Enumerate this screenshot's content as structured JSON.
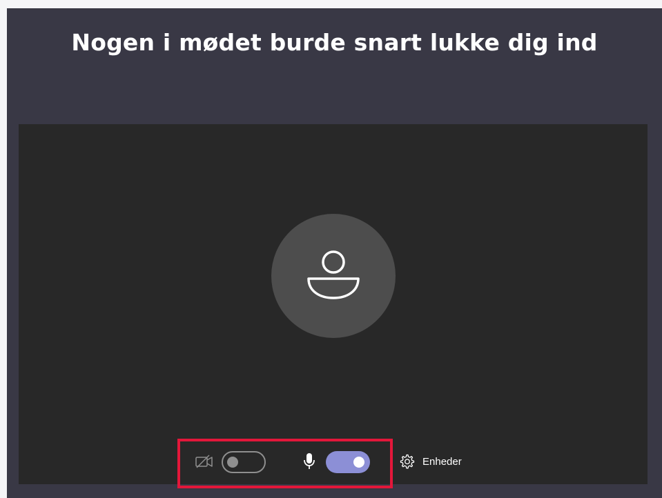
{
  "title": "Nogen i mødet burde snart lukke dig ind",
  "controls": {
    "camera": {
      "icon": "camera-off-icon",
      "state": "off"
    },
    "microphone": {
      "icon": "microphone-icon",
      "state": "on"
    },
    "devices": {
      "icon": "gear-icon",
      "label": "Enheder"
    }
  },
  "colors": {
    "background": "#393845",
    "preview": "#282828",
    "avatar": "#4d4d4d",
    "toggle_on": "#8c8fd6",
    "highlight": "#e3173a"
  }
}
